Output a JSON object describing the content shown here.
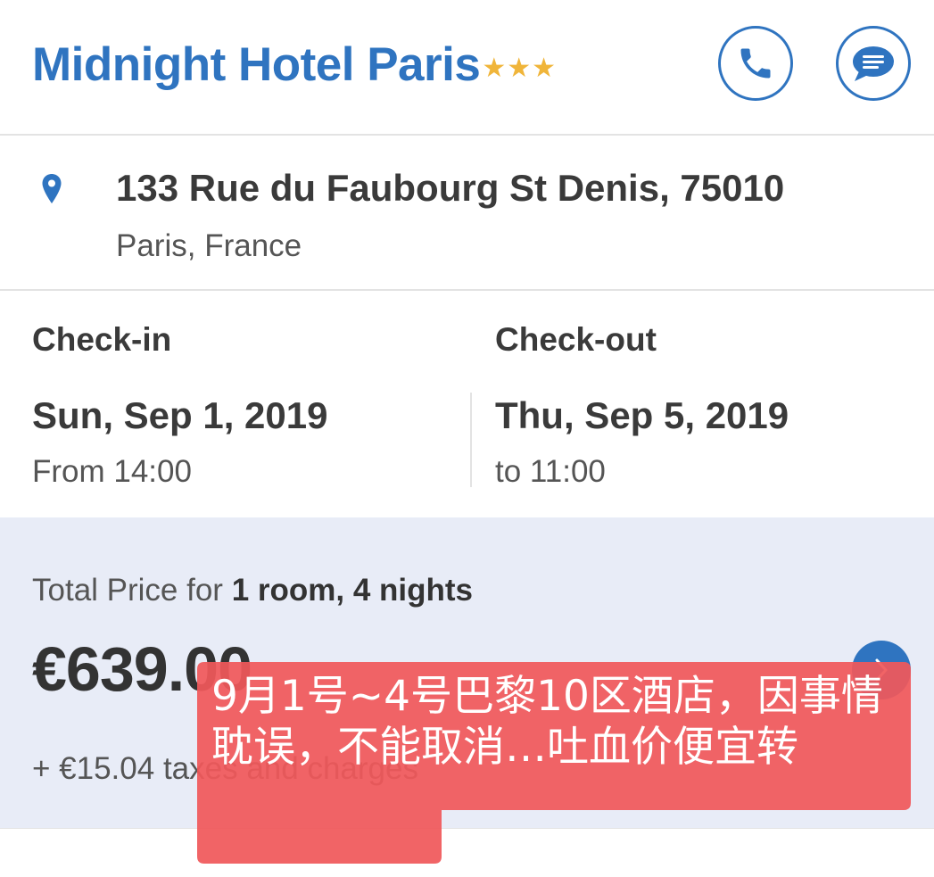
{
  "header": {
    "hotel_name": "Midnight Hotel Paris",
    "stars_text": "★★★",
    "star_rating": 3,
    "buttons": {
      "phone_icon": "phone-icon",
      "chat_icon": "chat-bubble-icon"
    }
  },
  "address": {
    "icon": "location-pin-icon",
    "line1": "133 Rue du Faubourg St Denis, 75010",
    "line2": "Paris, France"
  },
  "stay": {
    "check_in": {
      "label": "Check-in",
      "date": "Sun, Sep 1, 2019",
      "time": "From 14:00"
    },
    "check_out": {
      "label": "Check-out",
      "date": "Thu, Sep 5, 2019",
      "time": "to 11:00"
    }
  },
  "price": {
    "heading_prefix": "Total Price for ",
    "heading_bold": "1 room, 4 nights",
    "amount": "€639.00",
    "taxes": "+ €15.04 taxes and charges",
    "arrow_icon": "chevron-right-icon"
  },
  "overlay": {
    "text": "9月1号~4号巴黎10区酒店，因事情耽误，不能取消…吐血价便宜转"
  },
  "colors": {
    "brand_blue": "#2f74c0",
    "star_gold": "#f0b53a",
    "price_panel_bg": "#e8ecf7",
    "overlay_red": "#f0585a"
  }
}
